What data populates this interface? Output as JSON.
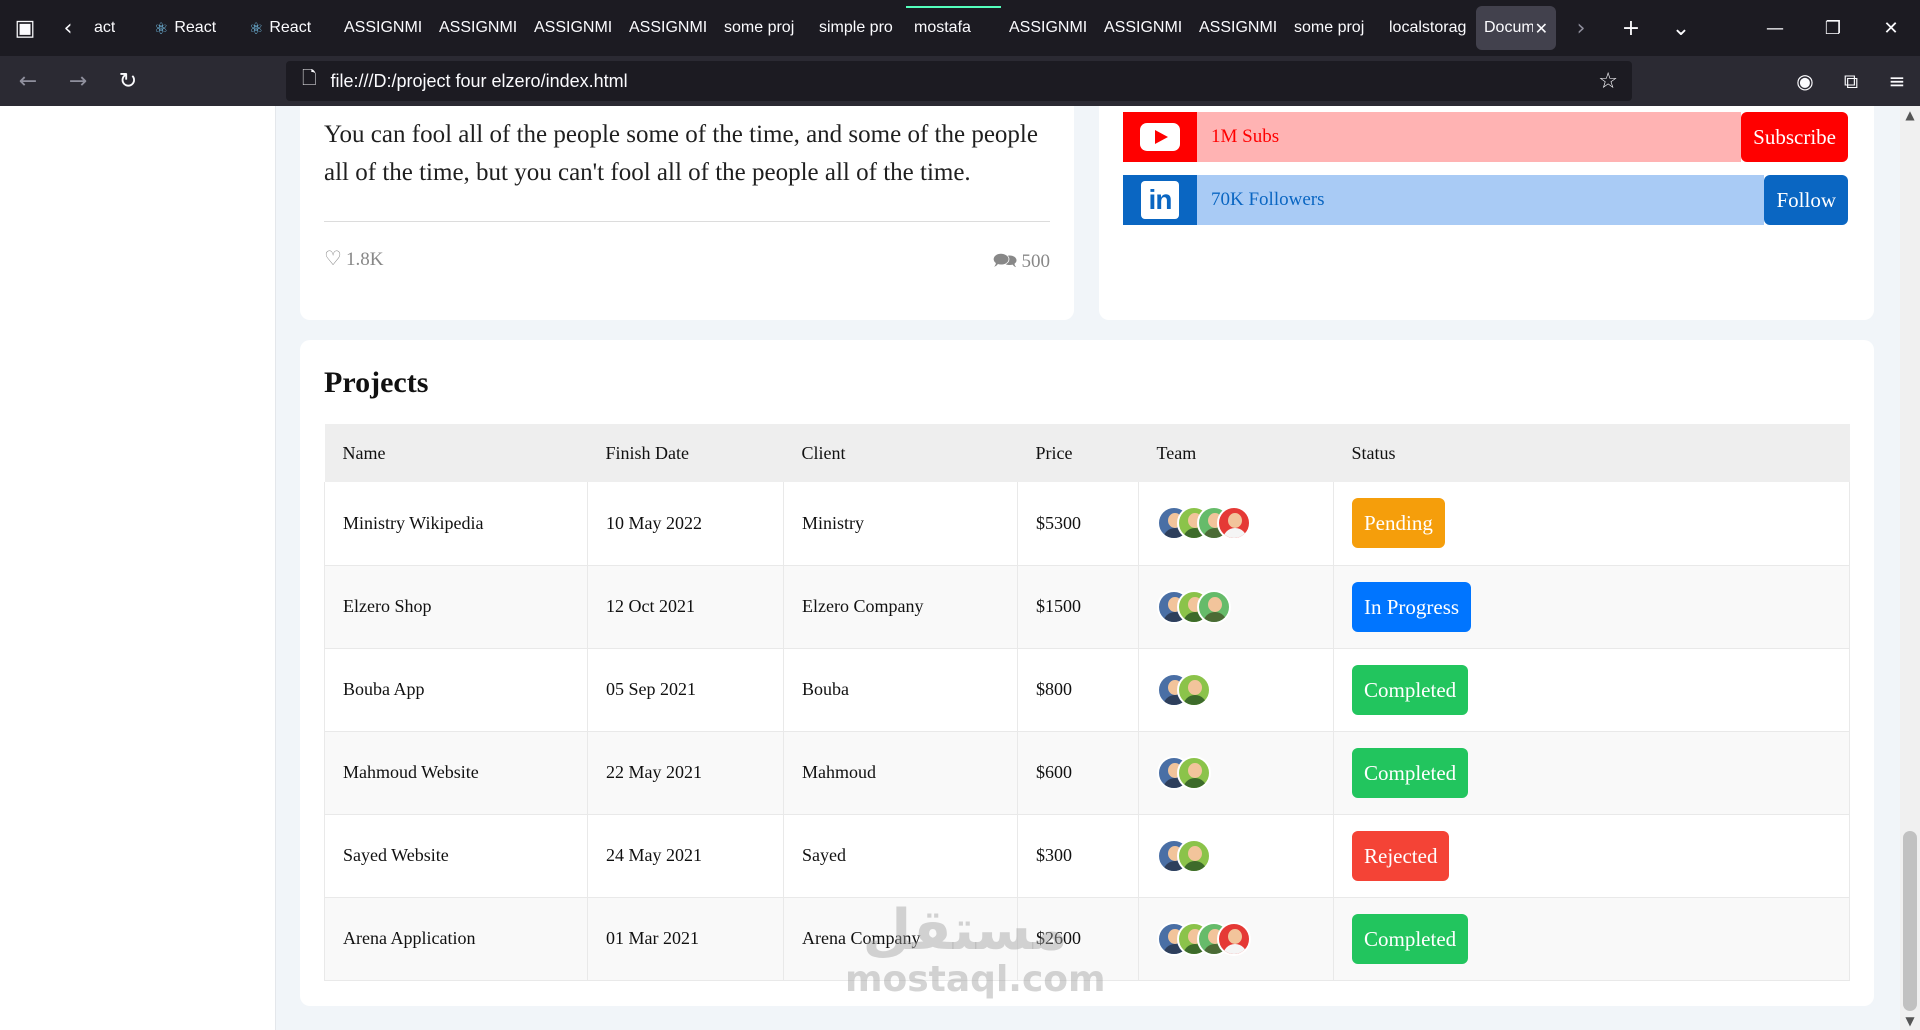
{
  "browser": {
    "tabs": [
      {
        "label": "act",
        "icon": ""
      },
      {
        "label": "React",
        "icon": "react-icon"
      },
      {
        "label": "React",
        "icon": "react-icon"
      },
      {
        "label": "ASSIGNMI",
        "icon": ""
      },
      {
        "label": "ASSIGNMI",
        "icon": ""
      },
      {
        "label": "ASSIGNMI",
        "icon": ""
      },
      {
        "label": "ASSIGNMI",
        "icon": ""
      },
      {
        "label": "some proj",
        "icon": ""
      },
      {
        "label": "simple pro",
        "icon": ""
      },
      {
        "label": "mostafa",
        "icon": ""
      },
      {
        "label": "ASSIGNMI",
        "icon": ""
      },
      {
        "label": "ASSIGNMI",
        "icon": ""
      },
      {
        "label": "ASSIGNMI",
        "icon": ""
      },
      {
        "label": "some proj",
        "icon": ""
      },
      {
        "label": "localstorag",
        "icon": ""
      }
    ],
    "active_tab": {
      "label": "Docum"
    },
    "url": "file:///D:/project four elzero/index.html"
  },
  "quote": {
    "text": "You can fool all of the people some of the time, and some of the people all of the time, but you can't fool all of the people all of the time.",
    "likes": "1.8K",
    "comments": "500"
  },
  "social": {
    "youtube": {
      "text": "1M Subs",
      "button": "Subscribe",
      "color": "#ff0000"
    },
    "linkedin": {
      "text": "70K Followers",
      "button": "Follow",
      "color": "#0a66c2"
    }
  },
  "projects": {
    "title": "Projects",
    "columns": [
      "Name",
      "Finish Date",
      "Client",
      "Price",
      "Team",
      "Status"
    ],
    "rows": [
      {
        "name": "Ministry Wikipedia",
        "date": "10 May 2022",
        "client": "Ministry",
        "price": "$5300",
        "team": 4,
        "status": "Pending",
        "status_color": "#f59e0b"
      },
      {
        "name": "Elzero Shop",
        "date": "12 Oct 2021",
        "client": "Elzero Company",
        "price": "$1500",
        "team": 3,
        "status": "In Progress",
        "status_color": "#0075ff"
      },
      {
        "name": "Bouba App",
        "date": "05 Sep 2021",
        "client": "Bouba",
        "price": "$800",
        "team": 2,
        "status": "Completed",
        "status_color": "#22c55e"
      },
      {
        "name": "Mahmoud Website",
        "date": "22 May 2021",
        "client": "Mahmoud",
        "price": "$600",
        "team": 2,
        "status": "Completed",
        "status_color": "#22c55e"
      },
      {
        "name": "Sayed Website",
        "date": "24 May 2021",
        "client": "Sayed",
        "price": "$300",
        "team": 2,
        "status": "Rejected",
        "status_color": "#f44336"
      },
      {
        "name": "Arena Application",
        "date": "01 Mar 2021",
        "client": "Arena Company",
        "price": "$2600",
        "team": 4,
        "status": "Completed",
        "status_color": "#22c55e"
      }
    ]
  },
  "watermark": {
    "arabic": "مستقل",
    "latin": "mostaql.com"
  }
}
